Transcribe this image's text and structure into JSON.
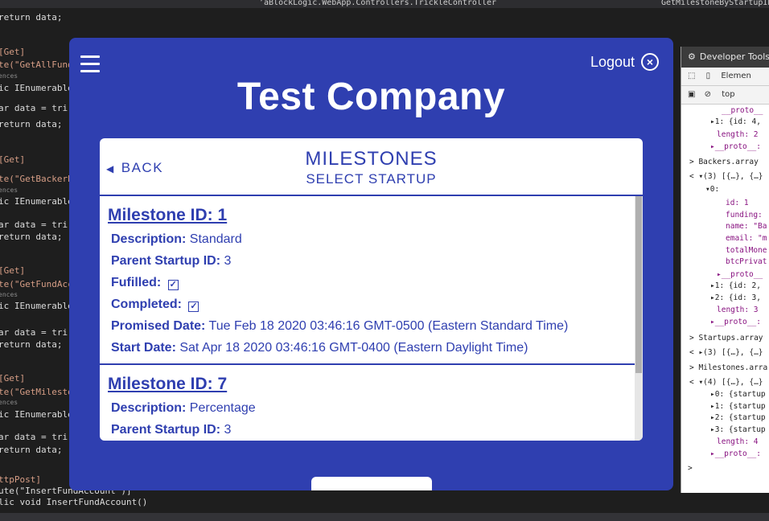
{
  "ide": {
    "top_tab_1": "’åBlockLogic.WebApp.Controllers.TrickleController",
    "top_tab_2": "GetMilestoneByStartupID",
    "code_lines": [
      {
        "text": "return data;",
        "cls": ""
      },
      {
        "text": "[Get]",
        "cls": "str"
      },
      {
        "text": "te(\"GetAllFund",
        "cls": "str"
      },
      {
        "text": "ences",
        "cls": "ref"
      },
      {
        "text": "ic IEnumerable",
        "cls": ""
      },
      {
        "text": "ar data = tri",
        "cls": ""
      },
      {
        "text": "return data;",
        "cls": ""
      },
      {
        "text": "[Get]",
        "cls": "str"
      },
      {
        "text": "te(\"GetBackerB",
        "cls": "str"
      },
      {
        "text": "ences",
        "cls": "ref"
      },
      {
        "text": "ic IEnumerable",
        "cls": ""
      },
      {
        "text": "ar data = tri",
        "cls": ""
      },
      {
        "text": "return data;",
        "cls": ""
      },
      {
        "text": "[Get]",
        "cls": "str"
      },
      {
        "text": "te(\"GetFundAcc",
        "cls": "str"
      },
      {
        "text": "ences",
        "cls": "ref"
      },
      {
        "text": "ic IEnumerable",
        "cls": ""
      },
      {
        "text": "ar data = tri",
        "cls": ""
      },
      {
        "text": "return data;",
        "cls": ""
      },
      {
        "text": "[Get]",
        "cls": "str"
      },
      {
        "text": "te(\"GetMilesto",
        "cls": "str"
      },
      {
        "text": "ences",
        "cls": "ref"
      },
      {
        "text": "ic IEnumerable",
        "cls": ""
      },
      {
        "text": "ar data = tri",
        "cls": ""
      },
      {
        "text": "return data;",
        "cls": ""
      }
    ],
    "bottom_lines": [
      "ttpPost]",
      "ute(\"InsertFundAccount\")]",
      "lic void InsertFundAccount()"
    ]
  },
  "devtools": {
    "title": "Developer Tools",
    "toolbar_elements": "Elemen",
    "context": "top",
    "lines": [
      {
        "text": "__proto__",
        "cls": "p"
      },
      {
        "text": "▸1: {id: 4,",
        "cls": ""
      },
      {
        "text": "length: 2",
        "cls": "p"
      },
      {
        "text": "▸__proto__:",
        "cls": "p"
      },
      {
        "text": "> Backers.array",
        "cls": ""
      },
      {
        "text": "< ▾(3) [{…}, {…}",
        "cls": ""
      },
      {
        "text": "▾0:",
        "cls": ""
      },
      {
        "text": "id: 1",
        "cls": "p"
      },
      {
        "text": "funding:",
        "cls": "p"
      },
      {
        "text": "name: \"Ba",
        "cls": "p"
      },
      {
        "text": "email: \"m",
        "cls": "p"
      },
      {
        "text": "totalMone",
        "cls": "p"
      },
      {
        "text": "btcPrivat",
        "cls": "p"
      },
      {
        "text": "▸__proto__",
        "cls": "p"
      },
      {
        "text": "▸1: {id: 2,",
        "cls": ""
      },
      {
        "text": "▸2: {id: 3,",
        "cls": ""
      },
      {
        "text": "length: 3",
        "cls": "p"
      },
      {
        "text": "▸__proto__:",
        "cls": "p"
      },
      {
        "text": "> Startups.array",
        "cls": ""
      },
      {
        "text": "< ▸(3) [{…}, {…}",
        "cls": ""
      },
      {
        "text": "> Milestones.arra",
        "cls": ""
      },
      {
        "text": "< ▾(4) [{…}, {…}",
        "cls": ""
      },
      {
        "text": "▸0: {startup",
        "cls": ""
      },
      {
        "text": "▸1: {startup",
        "cls": ""
      },
      {
        "text": "▸2: {startup",
        "cls": ""
      },
      {
        "text": "▸3: {startup",
        "cls": ""
      },
      {
        "text": "length: 4",
        "cls": "p"
      },
      {
        "text": "▸__proto__:",
        "cls": "p"
      },
      {
        "text": ">",
        "cls": ""
      }
    ]
  },
  "app": {
    "logout_label": "Logout",
    "company": "Test Company",
    "card": {
      "back_label": "BACK",
      "title": "MILESTONES",
      "subtitle": "SELECT STARTUP"
    },
    "milestones": [
      {
        "id_label": "Milestone ID: 1",
        "description_label": "Description:",
        "description": "Standard",
        "parent_label": "Parent Startup ID:",
        "parent": "3",
        "fulfilled_label": "Fufilled:",
        "fulfilled": "✓",
        "completed_label": "Completed:",
        "completed": "✓",
        "promised_label": "Promised Date:",
        "promised": "Tue Feb 18 2020 03:46:16 GMT-0500 (Eastern Standard Time)",
        "start_label": "Start Date:",
        "start": "Sat Apr 18 2020 03:46:16 GMT-0400 (Eastern Daylight Time)"
      },
      {
        "id_label": "Milestone ID: 7",
        "description_label": "Description:",
        "description": "Percentage",
        "parent_label": "Parent Startup ID:",
        "parent": "3"
      }
    ]
  }
}
